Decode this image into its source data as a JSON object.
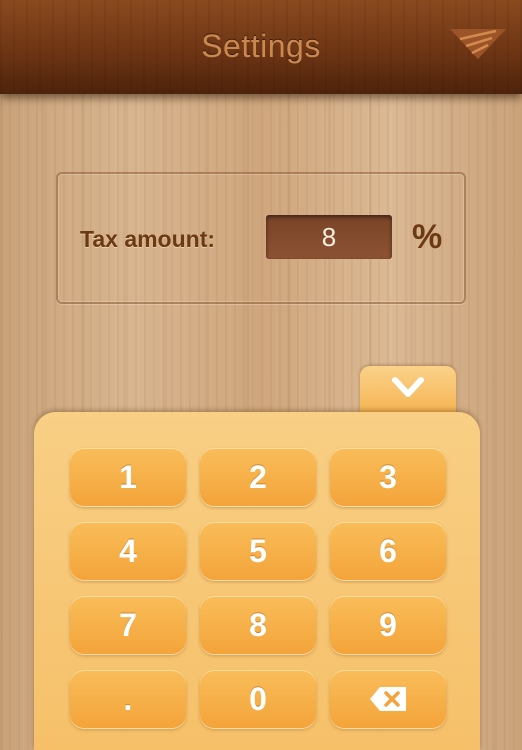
{
  "header": {
    "title": "Settings",
    "menu_icon": "wood-triangle-menu-icon"
  },
  "settings": {
    "tax_label": "Tax amount:",
    "tax_value": "8",
    "tax_unit": "%"
  },
  "keypad": {
    "collapse_icon": "chevron-down-icon",
    "keys": [
      "1",
      "2",
      "3",
      "4",
      "5",
      "6",
      "7",
      "8",
      "9",
      ".",
      "0"
    ],
    "delete_icon": "backspace-icon"
  },
  "colors": {
    "header": "#6e3514",
    "title": "#c9884f",
    "label": "#6b3a12",
    "input_bg": "#8c5233",
    "keypad_bg": "#f8cf85",
    "key": "#f4a43a"
  }
}
